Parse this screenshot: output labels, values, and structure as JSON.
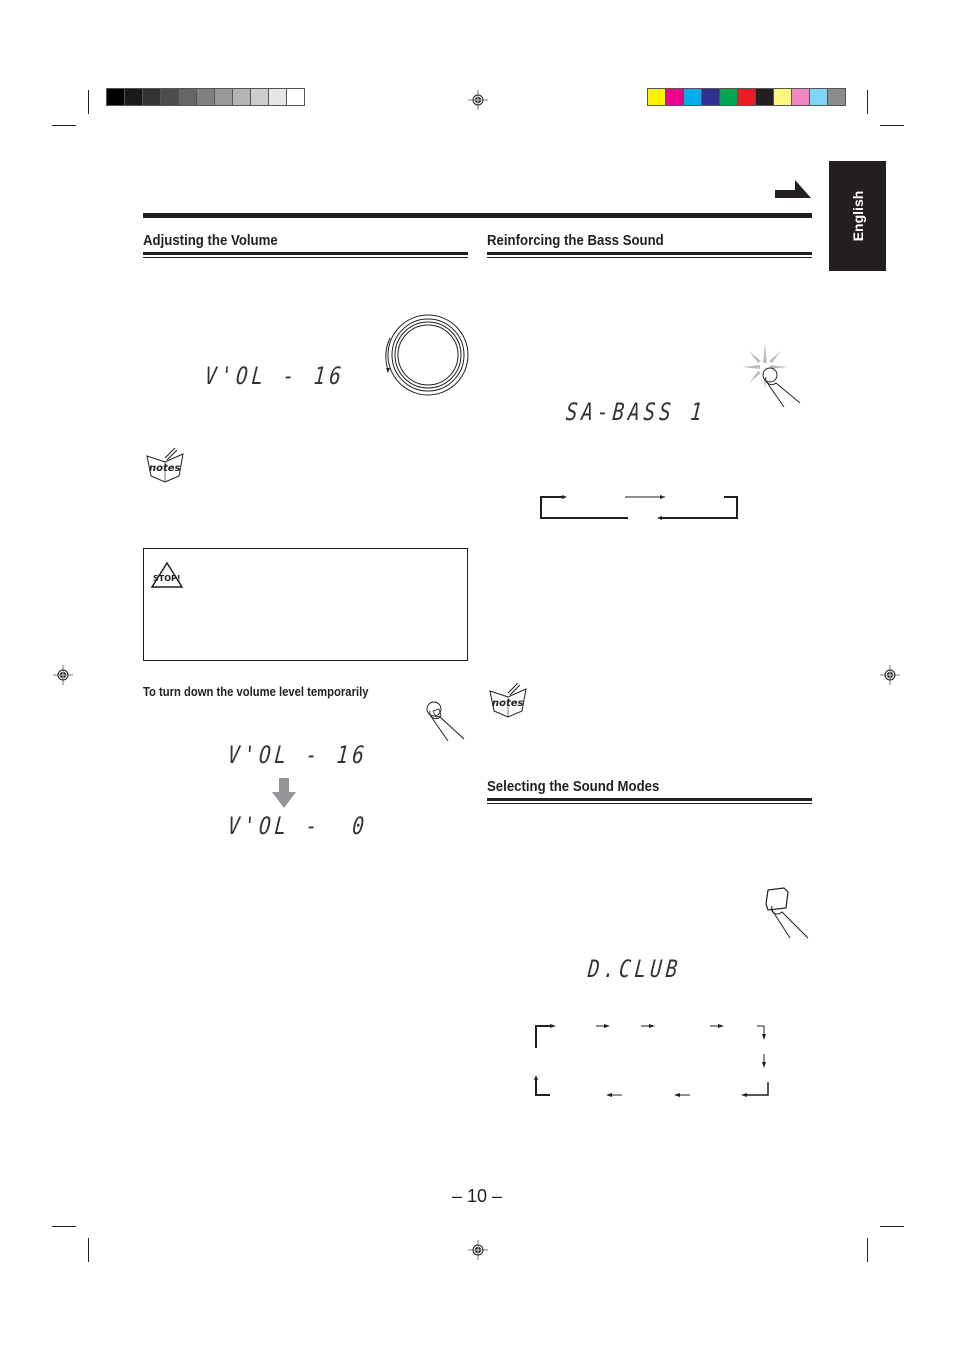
{
  "print_marks": {
    "grayscale_swatches": [
      "#000000",
      "#1a1a1a",
      "#333333",
      "#4d4d4d",
      "#666666",
      "#808080",
      "#999999",
      "#b3b3b3",
      "#cccccc",
      "#e6e6e6",
      "#ffffff"
    ],
    "color_swatches": [
      "#fff200",
      "#ec008c",
      "#00aeef",
      "#2e3192",
      "#00a651",
      "#ed1c24",
      "#231f20",
      "#fff77f",
      "#f287c3",
      "#7fd6f7",
      "#8c8c8c"
    ]
  },
  "language_tab": {
    "label": "English"
  },
  "continue_arrow": {
    "icon": "continue-arrow-icon"
  },
  "left_column": {
    "volume": {
      "title": "Adjusting the Volume",
      "display": "V'OL - 16",
      "dial_icon": "volume-dial-icon",
      "notes_icon": "notes-icon"
    },
    "caution": {
      "icon": "stop-icon"
    },
    "temporary": {
      "subheading": "To turn down the volume level temporarily",
      "button_icon": "finger-press-button-icon",
      "display_before": "V'OL - 16",
      "arrow_icon": "down-arrow-icon",
      "display_after": "V'OL -  0"
    }
  },
  "right_column": {
    "bass": {
      "title": "Reinforcing the Bass Sound",
      "button_icon": "finger-press-flashing-button-icon",
      "display": "SA-BASS 1",
      "cycle_diagram": "bass-cycle-diagram"
    },
    "notes_icon": "notes-icon",
    "sound_modes": {
      "title": "Selecting the Sound Modes",
      "button_icon": "finger-press-square-button-icon",
      "display": "D.CLUB",
      "cycle_diagram": "sound-mode-cycle-diagram"
    }
  },
  "footer": {
    "page_number": "– 10 –"
  }
}
